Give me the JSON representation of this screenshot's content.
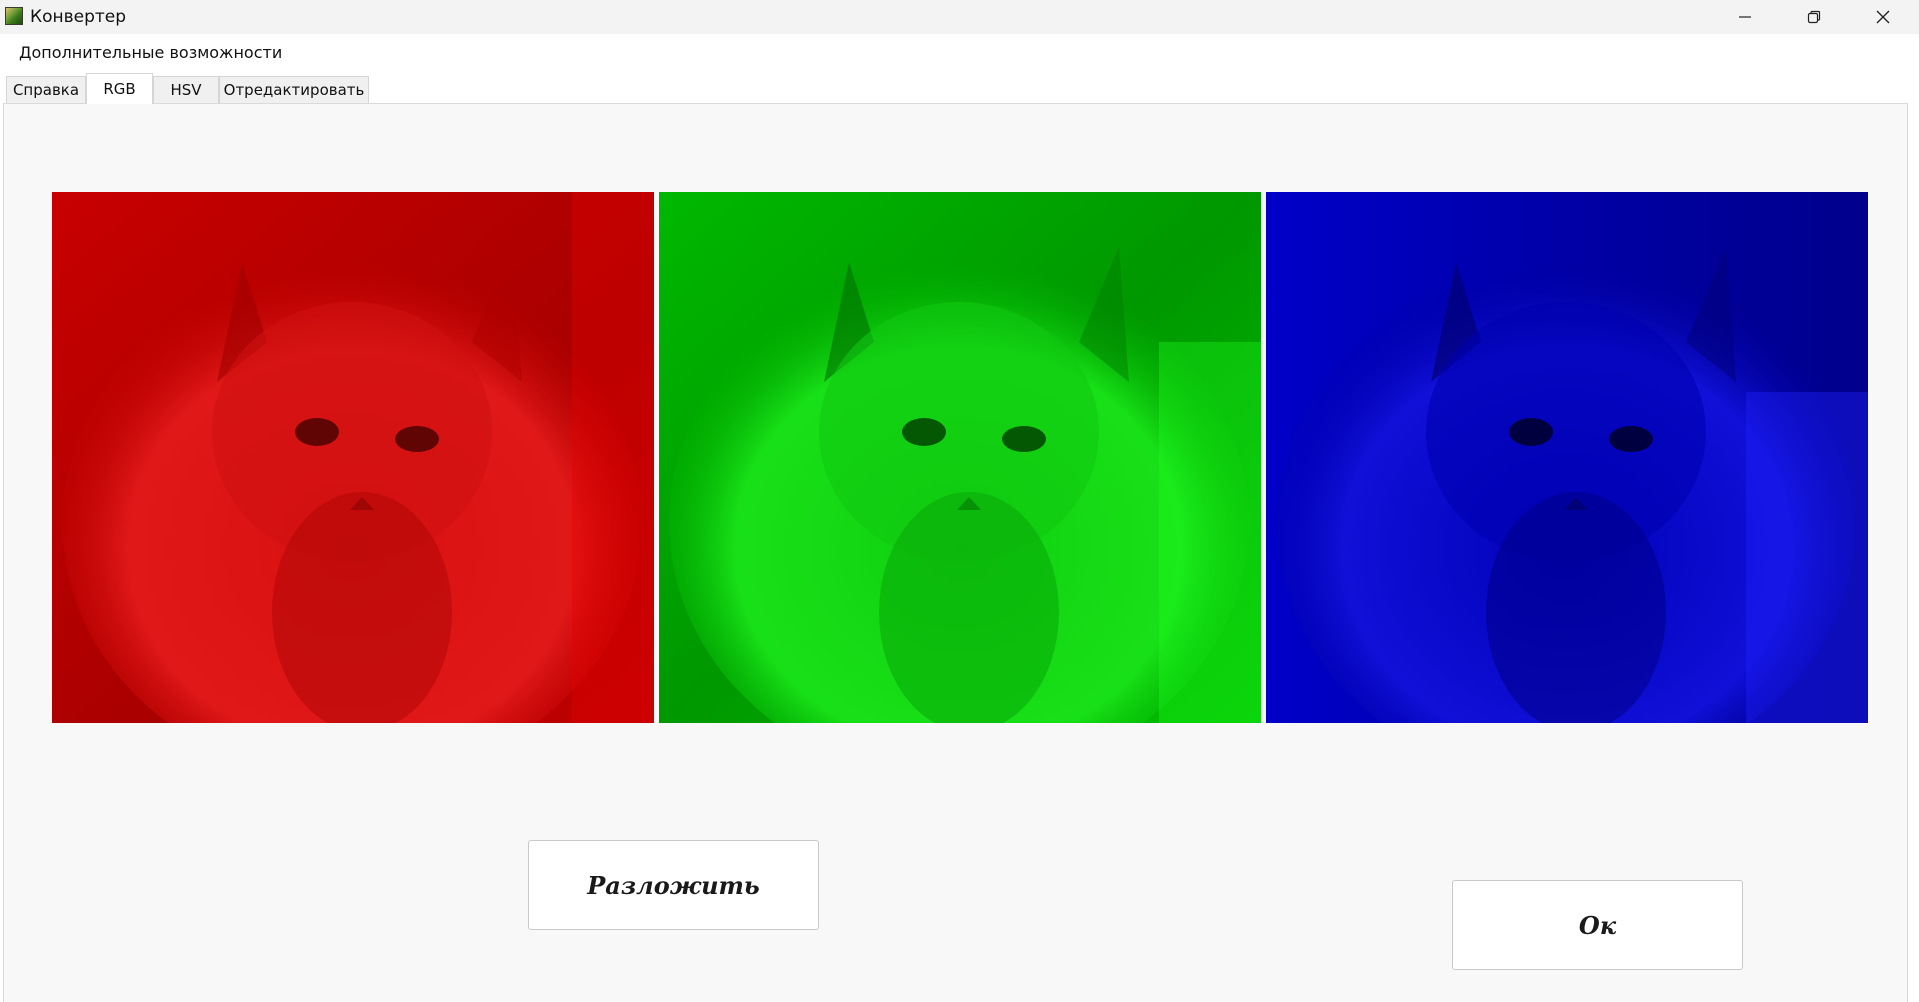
{
  "window": {
    "title": "Конвертер",
    "icon": "app-image-icon"
  },
  "title_controls": {
    "minimize_icon": "minimize-icon",
    "maximize_icon": "restore-icon",
    "close_icon": "close-icon"
  },
  "menu": {
    "items": [
      {
        "label": "Дополнительные возможности"
      }
    ]
  },
  "tabs": [
    {
      "label": "Справка",
      "active": false
    },
    {
      "label": "RGB",
      "active": true
    },
    {
      "label": "HSV",
      "active": false
    },
    {
      "label": "Отредактировать",
      "active": false
    }
  ],
  "channels": [
    {
      "name": "red-channel-image",
      "color": "#e00000"
    },
    {
      "name": "green-channel-image",
      "color": "#00e000"
    },
    {
      "name": "blue-channel-image",
      "color": "#0000e0"
    }
  ],
  "buttons": {
    "split_label": "Разложить",
    "ok_label": "Ок"
  }
}
